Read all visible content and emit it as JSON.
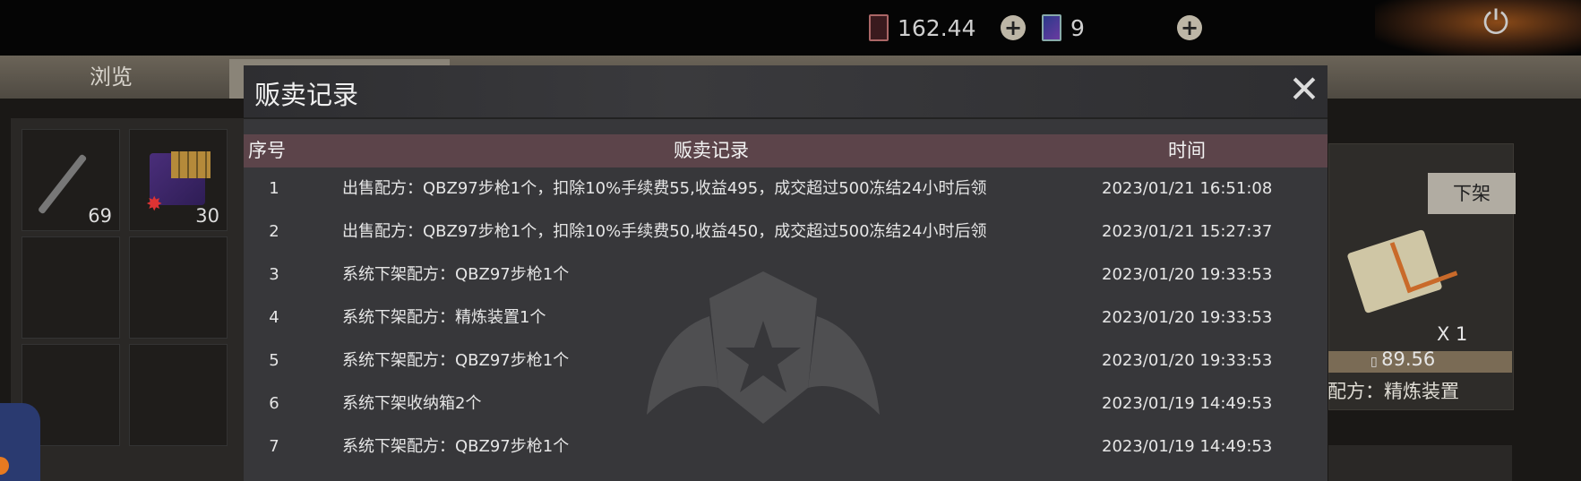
{
  "topbar": {
    "currency1": {
      "icon": "red-card-icon",
      "value": "162.44"
    },
    "currency2": {
      "icon": "blue-card-icon",
      "value": "9"
    }
  },
  "tabs": {
    "browse": "浏览"
  },
  "inventory": {
    "slots": [
      {
        "icon": "syringe-icon",
        "count": "69"
      },
      {
        "icon": "ammo-box-icon",
        "count": "30"
      }
    ]
  },
  "listing": {
    "delist_label": "下架",
    "quantity": "X 1",
    "price": "89.56",
    "item_name": "配方：精炼装置"
  },
  "dialog": {
    "title": "贩卖记录",
    "columns": {
      "index": "序号",
      "record": "贩卖记录",
      "time": "时间"
    },
    "rows": [
      {
        "index": "1",
        "record": "出售配方：QBZ97步枪1个，扣除10%手续费55,收益495，成交超过500冻结24小时后领",
        "time": "2023/01/21 16:51:08"
      },
      {
        "index": "2",
        "record": "出售配方：QBZ97步枪1个，扣除10%手续费50,收益450，成交超过500冻结24小时后领",
        "time": "2023/01/21 15:27:37"
      },
      {
        "index": "3",
        "record": "系统下架配方：QBZ97步枪1个",
        "time": "2023/01/20 19:33:53"
      },
      {
        "index": "4",
        "record": "系统下架配方：精炼装置1个",
        "time": "2023/01/20 19:33:53"
      },
      {
        "index": "5",
        "record": "系统下架配方：QBZ97步枪1个",
        "time": "2023/01/20 19:33:53"
      },
      {
        "index": "6",
        "record": "系统下架收纳箱2个",
        "time": "2023/01/19 14:49:53"
      },
      {
        "index": "7",
        "record": "系统下架配方：QBZ97步枪1个",
        "time": "2023/01/19 14:49:53"
      }
    ]
  },
  "colors": {
    "header_row": "#5c444a",
    "dialog_bg": "#37373a",
    "topbar_bg": "#050505"
  }
}
